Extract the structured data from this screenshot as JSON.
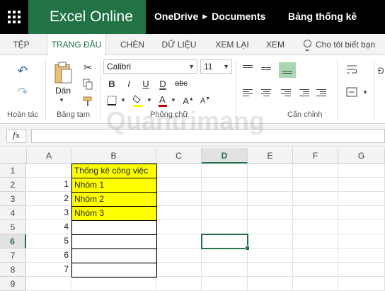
{
  "app": {
    "brand": "Excel Online"
  },
  "breadcrumb": {
    "root": "OneDrive",
    "folder": "Documents"
  },
  "document": {
    "title": "Bảng thống kê"
  },
  "tabs": [
    {
      "label": "TỆP"
    },
    {
      "label": "TRANG ĐẦU"
    },
    {
      "label": "CHÈN"
    },
    {
      "label": "DỮ LIỆU"
    },
    {
      "label": "XEM LẠI"
    },
    {
      "label": "XEM"
    }
  ],
  "tell_me": {
    "label": "Cho tôi biết bạn"
  },
  "ribbon": {
    "paste_label": "Dán",
    "groups": {
      "undo": "Hoàn tác",
      "clipboard": "Bảng tạm",
      "font": "Phông chữ",
      "alignment": "Căn chỉnh"
    },
    "font_name": "Calibri",
    "font_size": "11",
    "bold": "B",
    "italic": "I",
    "underline": "U",
    "double_underline": "D",
    "strikethrough": "abc"
  },
  "formula_bar": {
    "fx_label": "fx",
    "value": ""
  },
  "sheet": {
    "columns": [
      "A",
      "B",
      "C",
      "D",
      "E",
      "F",
      "G"
    ],
    "rows": [
      "1",
      "2",
      "3",
      "4",
      "5",
      "6",
      "7",
      "8",
      "9"
    ],
    "selected_column": "D",
    "selected_row": "6",
    "cells": {
      "B1": "Thống kê công việc",
      "A2": "1",
      "B2": "Nhóm 1",
      "A3": "2",
      "B3": "Nhóm 2",
      "A4": "3",
      "B4": "Nhóm 3",
      "A5": "4",
      "A6": "5",
      "A7": "6",
      "A8": "7"
    }
  },
  "colors": {
    "excel_green": "#217346",
    "highlight_yellow": "#ffff00"
  },
  "watermark": "Quantrimang"
}
